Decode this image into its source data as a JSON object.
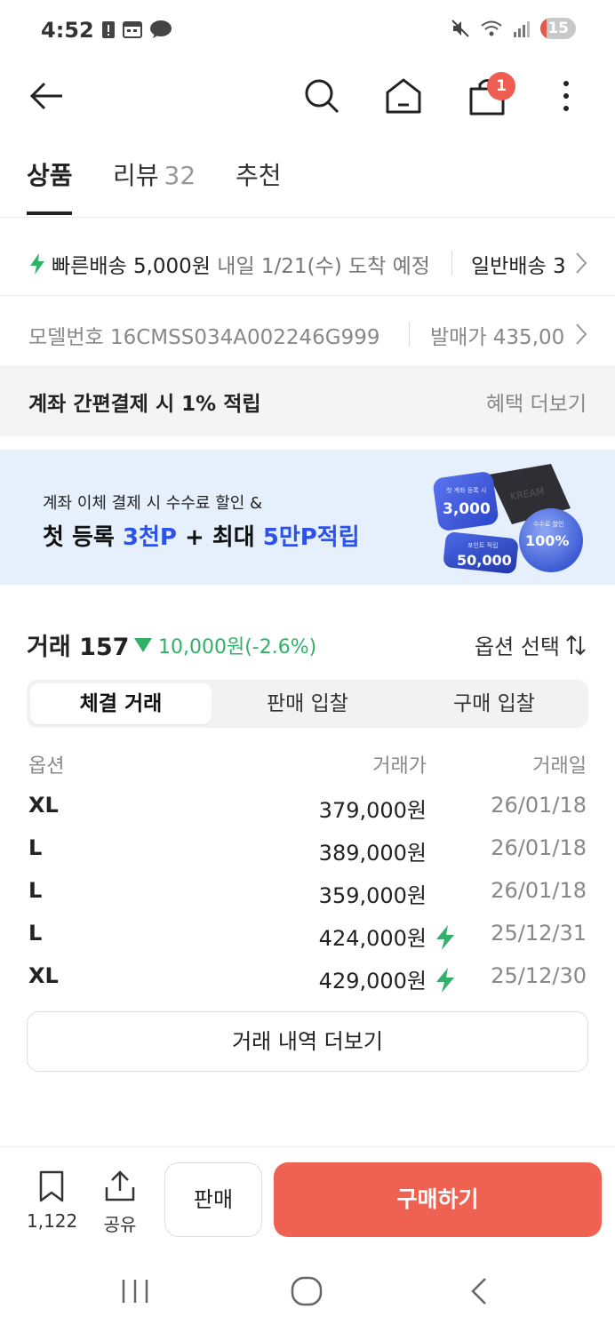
{
  "status_bar": {
    "time": "4:52",
    "battery": "15"
  },
  "app_bar": {
    "cart_badge": "1"
  },
  "tabs": {
    "product": "상품",
    "review": "리뷰",
    "review_count": "32",
    "recommend": "추천"
  },
  "delivery": {
    "fast_label": "빠른배송 5,000원",
    "fast_eta": "내일 1/21(수) 도착 예정",
    "general_label": "일반배송 3"
  },
  "model": {
    "model_number": "모델번호 16CMSS034A002246G999",
    "release_price": "발매가 435,00"
  },
  "points": {
    "title": "계좌 간편결제 시 1% 적립",
    "more": "혜택 더보기"
  },
  "ad_banner": {
    "line1": "계좌 이체 결제 시 수수료 할인 &",
    "line2_a": "첫 등록 ",
    "line2_b": "3천P",
    "line2_c": " + 최대 ",
    "line2_d": "5만P적립",
    "card1_small": "첫 계좌 등록 시",
    "card1_value": "3,000",
    "card2_small": "포인트 적립",
    "card2_value": "50,000",
    "card3_small": "수수료 할인",
    "card3_value": "100%",
    "brand_text": "KREAM"
  },
  "trades": {
    "title": "거래 157",
    "change": "10,000원(-2.6%)",
    "option_select": "옵션 선택",
    "segments": [
      "체결 거래",
      "판매 입찰",
      "구매 입찰"
    ],
    "headers": {
      "option": "옵션",
      "price": "거래가",
      "date": "거래일"
    },
    "rows": [
      {
        "option": "XL",
        "price": "379,000원",
        "date": "26/01/18",
        "fast": false
      },
      {
        "option": "L",
        "price": "389,000원",
        "date": "26/01/18",
        "fast": false
      },
      {
        "option": "L",
        "price": "359,000원",
        "date": "26/01/18",
        "fast": false
      },
      {
        "option": "L",
        "price": "424,000원",
        "date": "25/12/31",
        "fast": true
      },
      {
        "option": "XL",
        "price": "429,000원",
        "date": "25/12/30",
        "fast": true
      }
    ],
    "more_history": "거래 내역 더보기"
  },
  "bottom_bar": {
    "bookmark_count": "1,122",
    "share_label": "공유",
    "sell": "판매",
    "buy": "구매하기"
  },
  "colors": {
    "accent_red": "#ef6151",
    "fast_green": "#31b168",
    "banner_blue": "#2c53e6"
  }
}
